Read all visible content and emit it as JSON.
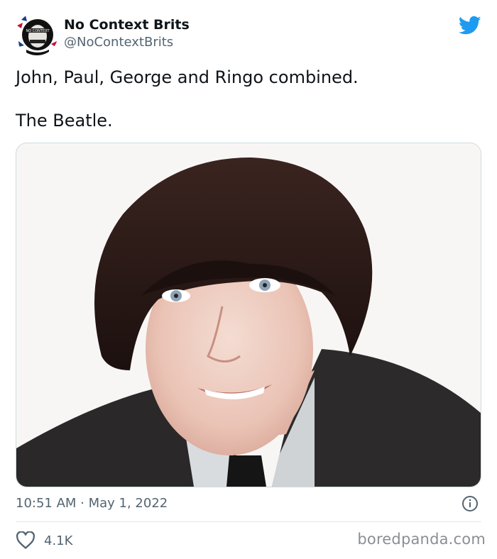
{
  "tweet": {
    "display_name": "No Context Brits",
    "handle": "@NoContextBrits",
    "avatar_icon": "punk-portrait-avatar",
    "platform_icon": "twitter-bird-icon",
    "lines": [
      "John, Paul, George and Ringo combined.",
      "The Beatle."
    ],
    "media": {
      "icon": "portrait-photo",
      "background": "#f8f6f5",
      "hair_color": "#2c1a17",
      "suit_color": "#2a2828"
    },
    "timestamp": "10:51 AM · May 1, 2022",
    "likes": "4.1K"
  },
  "watermark": "boredpanda.com",
  "colors": {
    "text": "#0f1419",
    "muted": "#536471",
    "border": "#cfd9de",
    "twitter_blue": "#1d9bf0"
  }
}
